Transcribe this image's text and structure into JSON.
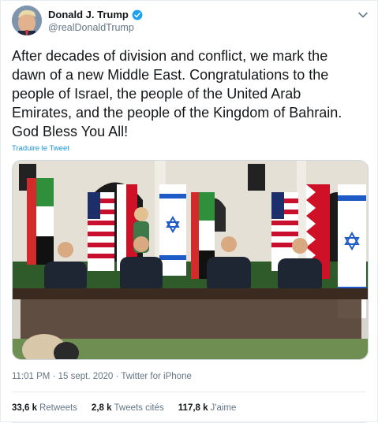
{
  "author": {
    "display_name": "Donald J. Trump",
    "handle": "@realDonaldTrump",
    "verified": true
  },
  "tweet": {
    "text": "After decades of division and conflict, we mark the\ndawn of a new Middle East. Congratulations to the\npeople of Israel, the people of the United Arab\nEmirates, and the people of the Kingdom of Bahrain.\nGod Bless You All!",
    "translate_label": "Traduire le Tweet"
  },
  "meta": {
    "time": "11:01 PM",
    "date": "15 sept. 2020",
    "source": "Twitter for iPhone",
    "separator": "·"
  },
  "stats": {
    "retweets_count": "33,6 k",
    "retweets_label": "Retweets",
    "quotes_count": "2,8 k",
    "quotes_label": "Tweets cités",
    "likes_count": "117,8 k",
    "likes_label": "J'aime"
  },
  "colors": {
    "accent": "#1b95e0",
    "text_primary": "#14171a",
    "text_secondary": "#657786",
    "border": "#e6ecf0"
  },
  "icons": {
    "verified": "verified-badge-icon",
    "menu": "chevron-down-icon"
  }
}
